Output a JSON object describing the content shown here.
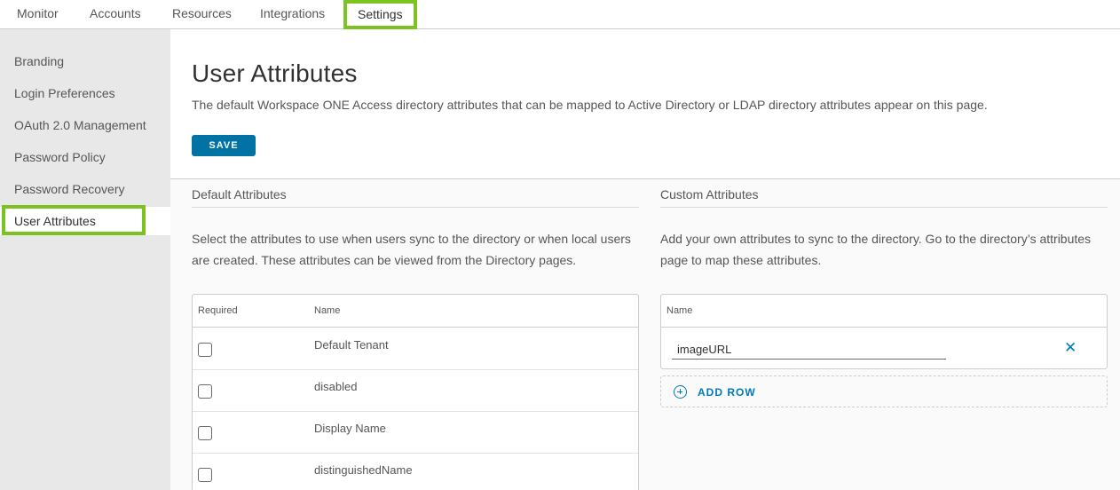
{
  "nav": {
    "tabs": [
      {
        "label": "Monitor"
      },
      {
        "label": "Accounts"
      },
      {
        "label": "Resources"
      },
      {
        "label": "Integrations"
      },
      {
        "label": "Settings",
        "active": true
      }
    ]
  },
  "sidebar": {
    "items": [
      {
        "label": "Branding"
      },
      {
        "label": "Login Preferences"
      },
      {
        "label": "OAuth 2.0 Management"
      },
      {
        "label": "Password Policy"
      },
      {
        "label": "Password Recovery"
      },
      {
        "label": "User Attributes",
        "active": true
      }
    ]
  },
  "page": {
    "title": "User Attributes",
    "description": "The default Workspace ONE Access directory attributes that can be mapped to Active Directory or LDAP directory attributes appear on this page.",
    "save_label": "SAVE"
  },
  "default_attributes": {
    "title": "Default Attributes",
    "description": "Select the attributes to use when users sync to the directory or when local users are created. These attributes can be viewed from the Directory pages.",
    "columns": {
      "required": "Required",
      "name": "Name"
    },
    "rows": [
      {
        "name": "Default Tenant",
        "required": false
      },
      {
        "name": "disabled",
        "required": false
      },
      {
        "name": "Display Name",
        "required": false
      },
      {
        "name": "distinguishedName",
        "required": false
      }
    ]
  },
  "custom_attributes": {
    "title": "Custom Attributes",
    "description": "Add your own attributes to sync to the directory. Go to the directory’s attributes page to map these attributes.",
    "columns": {
      "name": "Name"
    },
    "rows": [
      {
        "value": "imageURL"
      }
    ],
    "add_row_label": "ADD ROW"
  },
  "icons": {
    "remove": "close-icon",
    "add": "plus-circle-icon"
  },
  "colors": {
    "accent": "#0072a3",
    "link": "#0079b8",
    "highlight": "#7cc220",
    "sidebar_bg": "#e8e8e8"
  }
}
